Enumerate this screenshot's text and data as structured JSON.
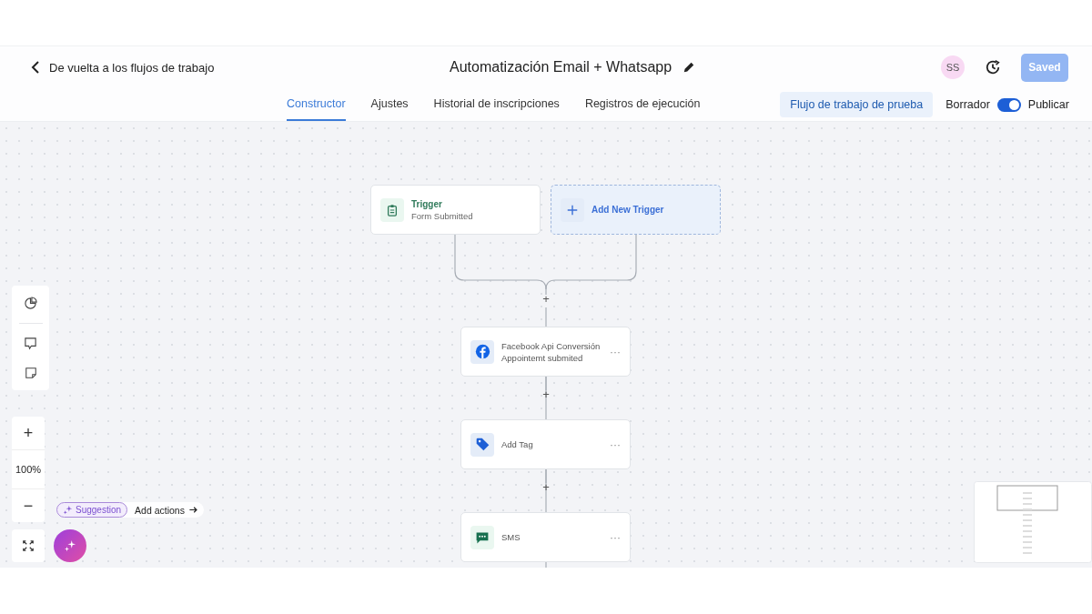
{
  "header": {
    "back_link": "De vuelta a los flujos de trabajo",
    "title": "Automatización Email + Whatsapp",
    "avatar": "SS",
    "save_button": {
      "label": "Saved",
      "disabled": true
    }
  },
  "tabs": [
    {
      "label": "Constructor",
      "selected": true
    },
    {
      "label": "Ajustes",
      "selected": false
    },
    {
      "label": "Historial de inscripciones",
      "selected": false
    },
    {
      "label": "Registros de ejecución",
      "selected": false
    }
  ],
  "test_button": "Flujo de trabajo de prueba",
  "publish_toggle": {
    "off_label": "Borrador",
    "on_label": "Publicar",
    "on": true
  },
  "triggers": [
    {
      "kind": "form",
      "title": "Trigger",
      "subtitle": "Form Submitted"
    },
    {
      "kind": "add",
      "title": "Add New Trigger"
    }
  ],
  "actions": [
    {
      "kind": "facebook",
      "title": "Facebook Api Conversión",
      "subtitle": "Appointemt submited",
      "menu": "···"
    },
    {
      "kind": "tag",
      "title": "Add Tag",
      "menu": "···"
    },
    {
      "kind": "sms",
      "title": "SMS",
      "menu": "···"
    }
  ],
  "add_step": "+",
  "zoom": {
    "plus": "+",
    "level": "100%",
    "minus": "−"
  },
  "suggestion": {
    "badge": "Suggestion",
    "action": "Add actions"
  }
}
